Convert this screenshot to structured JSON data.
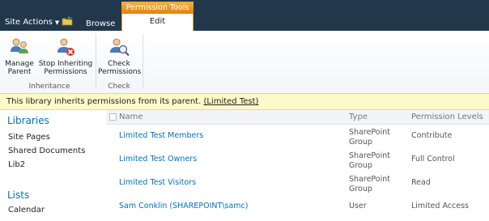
{
  "topbar": {
    "site_actions": "Site Actions",
    "tab_browse": "Browse",
    "context_group": "Permission Tools",
    "tab_edit": "Edit"
  },
  "ribbon": {
    "buttons": [
      {
        "label": "Manage Parent"
      },
      {
        "label": "Stop Inheriting Permissions"
      },
      {
        "label": "Check Permissions"
      }
    ],
    "groups": [
      "Inheritance",
      "Check"
    ]
  },
  "notice": {
    "text": "This library inherits permissions from its parent.",
    "link": "(Limited Test)"
  },
  "leftnav": {
    "libraries_heading": "Libraries",
    "libraries": [
      "Site Pages",
      "Shared Documents",
      "Lib2"
    ],
    "lists_heading": "Lists",
    "lists": [
      "Calendar"
    ]
  },
  "table": {
    "headers": {
      "name": "Name",
      "type": "Type",
      "perm": "Permission Levels"
    },
    "rows": [
      {
        "name": "Limited Test Members",
        "type": "SharePoint Group",
        "perm": "Contribute"
      },
      {
        "name": "Limited Test Owners",
        "type": "SharePoint Group",
        "perm": "Full Control"
      },
      {
        "name": "Limited Test Visitors",
        "type": "SharePoint Group",
        "perm": "Read"
      },
      {
        "name": "Sam Conklin (SHAREPOINT\\samc)",
        "type": "User",
        "perm": "Limited Access"
      }
    ]
  }
}
